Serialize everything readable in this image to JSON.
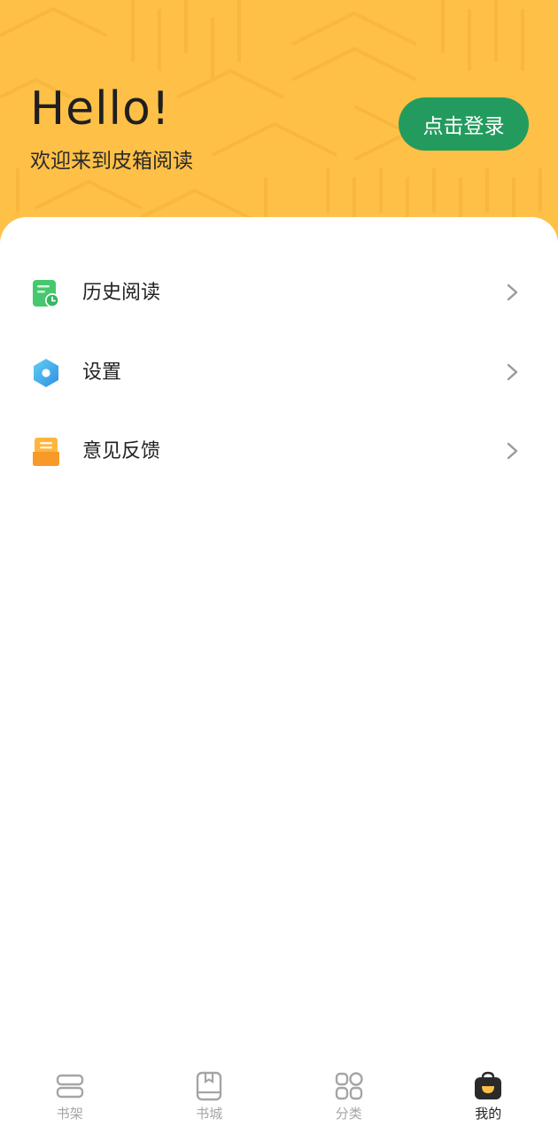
{
  "header": {
    "greeting": "Hello!",
    "subtitle": "欢迎来到皮箱阅读",
    "login_label": "点击登录"
  },
  "menu": {
    "items": [
      {
        "label": "历史阅读",
        "icon": "history-book-icon"
      },
      {
        "label": "设置",
        "icon": "settings-hexagon-icon"
      },
      {
        "label": "意见反馈",
        "icon": "feedback-icon"
      }
    ]
  },
  "bottom_nav": {
    "items": [
      {
        "label": "书架",
        "icon": "bookshelf-icon",
        "active": false
      },
      {
        "label": "书城",
        "icon": "bookstore-icon",
        "active": false
      },
      {
        "label": "分类",
        "icon": "category-grid-icon",
        "active": false
      },
      {
        "label": "我的",
        "icon": "profile-bag-icon",
        "active": true
      }
    ]
  },
  "colors": {
    "header_bg": "#fec047",
    "login_button": "#239b5e",
    "active_nav": "#222222",
    "inactive_nav": "#a5a5a5"
  }
}
